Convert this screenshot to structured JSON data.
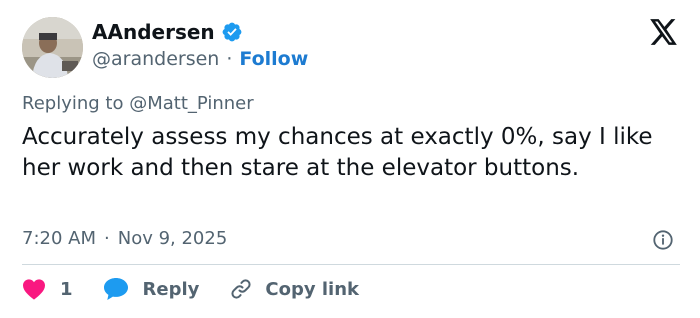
{
  "author": {
    "display_name": "AAndersen",
    "handle": "@arandersen",
    "separator": "·",
    "follow_label": "Follow",
    "verified_color": "#1d9bf0"
  },
  "reply": {
    "prefix": "Replying to",
    "to_handle": "@Matt_Pinner"
  },
  "tweet": {
    "text": "Accurately assess my chances at exactly 0%, say I like her work and then stare at the elevator buttons."
  },
  "meta": {
    "time": "7:20 AM",
    "separator": "·",
    "date": "Nov 9, 2025"
  },
  "actions": {
    "like_count": "1",
    "reply_label": "Reply",
    "copy_label": "Copy link",
    "like_color": "#f91880",
    "reply_color": "#1d9bf0"
  },
  "icons": [
    "avatar",
    "verified-badge-icon",
    "x-logo-icon",
    "info-icon",
    "heart-icon",
    "speech-bubble-icon",
    "link-icon"
  ]
}
